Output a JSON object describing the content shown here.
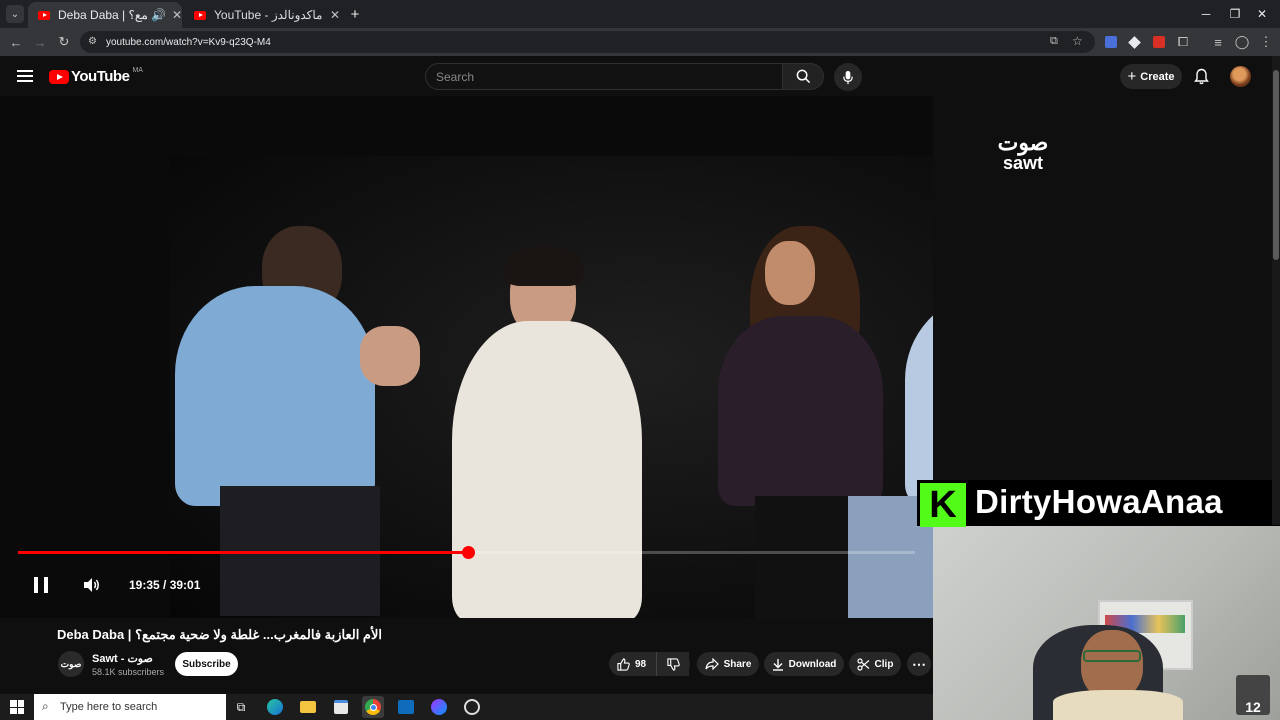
{
  "browser": {
    "tabs": [
      {
        "title": "Deba Daba | ضحية مجتمع؟",
        "active": true
      },
      {
        "title": "YouTube - اجي نجربو ماكدونالدز",
        "active": false
      }
    ],
    "url": "youtube.com/watch?v=Kv9-q23Q-M4",
    "new_tab": "+",
    "window": {
      "minimize": "─",
      "maximize": "❐",
      "close": "✕"
    }
  },
  "masthead": {
    "logo_text": "YouTube",
    "region": "MA",
    "search_placeholder": "Search",
    "create_label": "Create"
  },
  "player": {
    "channel_logo": "صوت Sawt",
    "time": "19:35 / 39:01",
    "progress_fraction": 0.502,
    "overlay_banner": "DirtyHowaAnaa",
    "overlay_badge": "K",
    "cam_counter": "12"
  },
  "video": {
    "title": "Deba Daba | الأم العازبة فالمغرب... غلطة ولا ضحية مجتمع؟",
    "channel": "Sawt - صوت",
    "subscribers": "58.1K subscribers",
    "subscribe_label": "Subscribe",
    "likes": "98",
    "share_label": "Share",
    "download_label": "Download",
    "clip_label": "Clip",
    "more_label": "⋯"
  },
  "taskbar": {
    "search_placeholder": "Type here to search"
  },
  "colors": {
    "accent": "#ff0000",
    "kick_green": "#53fc18",
    "background": "#0f0f0f"
  }
}
